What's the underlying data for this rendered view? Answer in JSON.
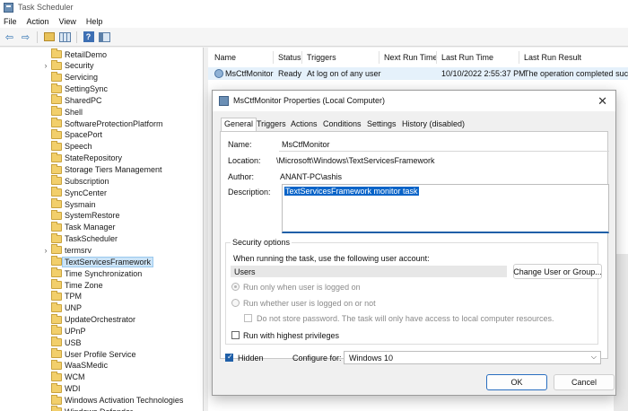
{
  "window": {
    "title": "Task Scheduler"
  },
  "menu": [
    "File",
    "Action",
    "View",
    "Help"
  ],
  "toolbar": {
    "back_icon": "back-arrow-icon",
    "forward_icon": "forward-arrow-icon",
    "back_glyph": "⇦",
    "forward_glyph": "⇨",
    "help_glyph": "?"
  },
  "tree": {
    "items": [
      {
        "label": "RetailDemo",
        "expand": ""
      },
      {
        "label": "Security",
        "expand": "›"
      },
      {
        "label": "Servicing",
        "expand": ""
      },
      {
        "label": "SettingSync",
        "expand": ""
      },
      {
        "label": "SharedPC",
        "expand": ""
      },
      {
        "label": "Shell",
        "expand": ""
      },
      {
        "label": "SoftwareProtectionPlatform",
        "expand": ""
      },
      {
        "label": "SpacePort",
        "expand": ""
      },
      {
        "label": "Speech",
        "expand": ""
      },
      {
        "label": "StateRepository",
        "expand": ""
      },
      {
        "label": "Storage Tiers Management",
        "expand": ""
      },
      {
        "label": "Subscription",
        "expand": ""
      },
      {
        "label": "SyncCenter",
        "expand": ""
      },
      {
        "label": "Sysmain",
        "expand": ""
      },
      {
        "label": "SystemRestore",
        "expand": ""
      },
      {
        "label": "Task Manager",
        "expand": ""
      },
      {
        "label": "TaskScheduler",
        "expand": ""
      },
      {
        "label": "termsrv",
        "expand": "›"
      },
      {
        "label": "TextServicesFramework",
        "expand": "",
        "selected": true
      },
      {
        "label": "Time Synchronization",
        "expand": ""
      },
      {
        "label": "Time Zone",
        "expand": ""
      },
      {
        "label": "TPM",
        "expand": ""
      },
      {
        "label": "UNP",
        "expand": ""
      },
      {
        "label": "UpdateOrchestrator",
        "expand": ""
      },
      {
        "label": "UPnP",
        "expand": ""
      },
      {
        "label": "USB",
        "expand": ""
      },
      {
        "label": "User Profile Service",
        "expand": ""
      },
      {
        "label": "WaaSMedic",
        "expand": ""
      },
      {
        "label": "WCM",
        "expand": ""
      },
      {
        "label": "WDI",
        "expand": ""
      },
      {
        "label": "Windows Activation Technologies",
        "expand": ""
      },
      {
        "label": "Windows Defender",
        "expand": ""
      }
    ]
  },
  "task_list": {
    "columns": [
      "Name",
      "Status",
      "Triggers",
      "Next Run Time",
      "Last Run Time",
      "Last Run Result"
    ],
    "row": {
      "name": "MsCtfMonitor",
      "status": "Ready",
      "triggers": "At log on of any user",
      "next_run": "",
      "last_run": "10/10/2022 2:55:37 PM",
      "result": "The operation completed succe"
    }
  },
  "dialog": {
    "title": "MsCtfMonitor Properties (Local Computer)",
    "close_glyph": "✕",
    "tabs": [
      "General",
      "Triggers",
      "Actions",
      "Conditions",
      "Settings",
      "History (disabled)"
    ],
    "active_tab": "General",
    "name_label": "Name:",
    "name_value": "MsCtfMonitor",
    "location_label": "Location:",
    "location_value": "\\Microsoft\\Windows\\TextServicesFramework",
    "author_label": "Author:",
    "author_value": "ANANT-PC\\ashis",
    "description_label": "Description:",
    "description_value": "TextServicesFramework monitor task",
    "security_legend": "Security options",
    "run_as_text": "When running the task, use the following user account:",
    "user_account": "Users",
    "change_user_button": "Change User or Group...",
    "radio_logged_on": "Run only when user is logged on",
    "radio_whether": "Run whether user is logged on or not",
    "no_store_password": "Do not store password.  The task will only have access to local computer resources.",
    "highest_privileges": "Run with highest privileges",
    "hidden_label": "Hidden",
    "hidden_checked": true,
    "configure_label": "Configure for:",
    "configure_value": "Windows 10",
    "ok_button": "OK",
    "cancel_button": "Cancel"
  },
  "colors": {
    "selection": "#cce4f7",
    "accent": "#1f5fa8",
    "text_selection": "#0a64c8"
  }
}
